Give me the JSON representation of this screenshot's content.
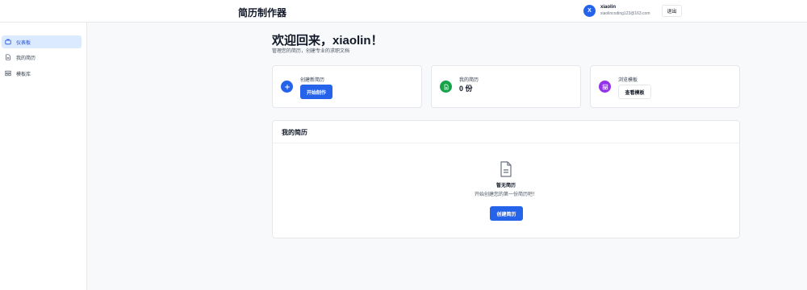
{
  "header": {
    "app_title": "简历制作器",
    "user": {
      "avatar_letter": "X",
      "name": "xiaolin",
      "email": "xiaolincoding123@163.com"
    },
    "logout_label": "退出"
  },
  "sidebar": {
    "items": [
      {
        "label": "仪表板",
        "icon": "dashboard-icon",
        "active": true
      },
      {
        "label": "我的简历",
        "icon": "document-icon",
        "active": false
      },
      {
        "label": "模板库",
        "icon": "template-icon",
        "active": false
      }
    ]
  },
  "main": {
    "welcome": "欢迎回来，xiaolin！",
    "subtitle": "管理您的简历，创建专业的求职文档",
    "cards": [
      {
        "label": "创建新简历",
        "button": "开始制作",
        "icon": "plus-icon",
        "color": "#2563eb"
      },
      {
        "label": "我的简历",
        "value": "0 份",
        "icon": "document-icon",
        "color": "#16a34a"
      },
      {
        "label": "浏览模板",
        "button": "查看模板",
        "icon": "template-icon",
        "color": "#9333ea"
      }
    ],
    "resume_panel": {
      "title": "我的简历",
      "empty_title": "暂无简历",
      "empty_desc": "开始创建您的第一份简历吧！",
      "create_button": "创建简历"
    }
  },
  "colors": {
    "accent": "#2563eb",
    "green": "#16a34a",
    "purple": "#9333ea",
    "active_bg": "#dbeafe"
  }
}
